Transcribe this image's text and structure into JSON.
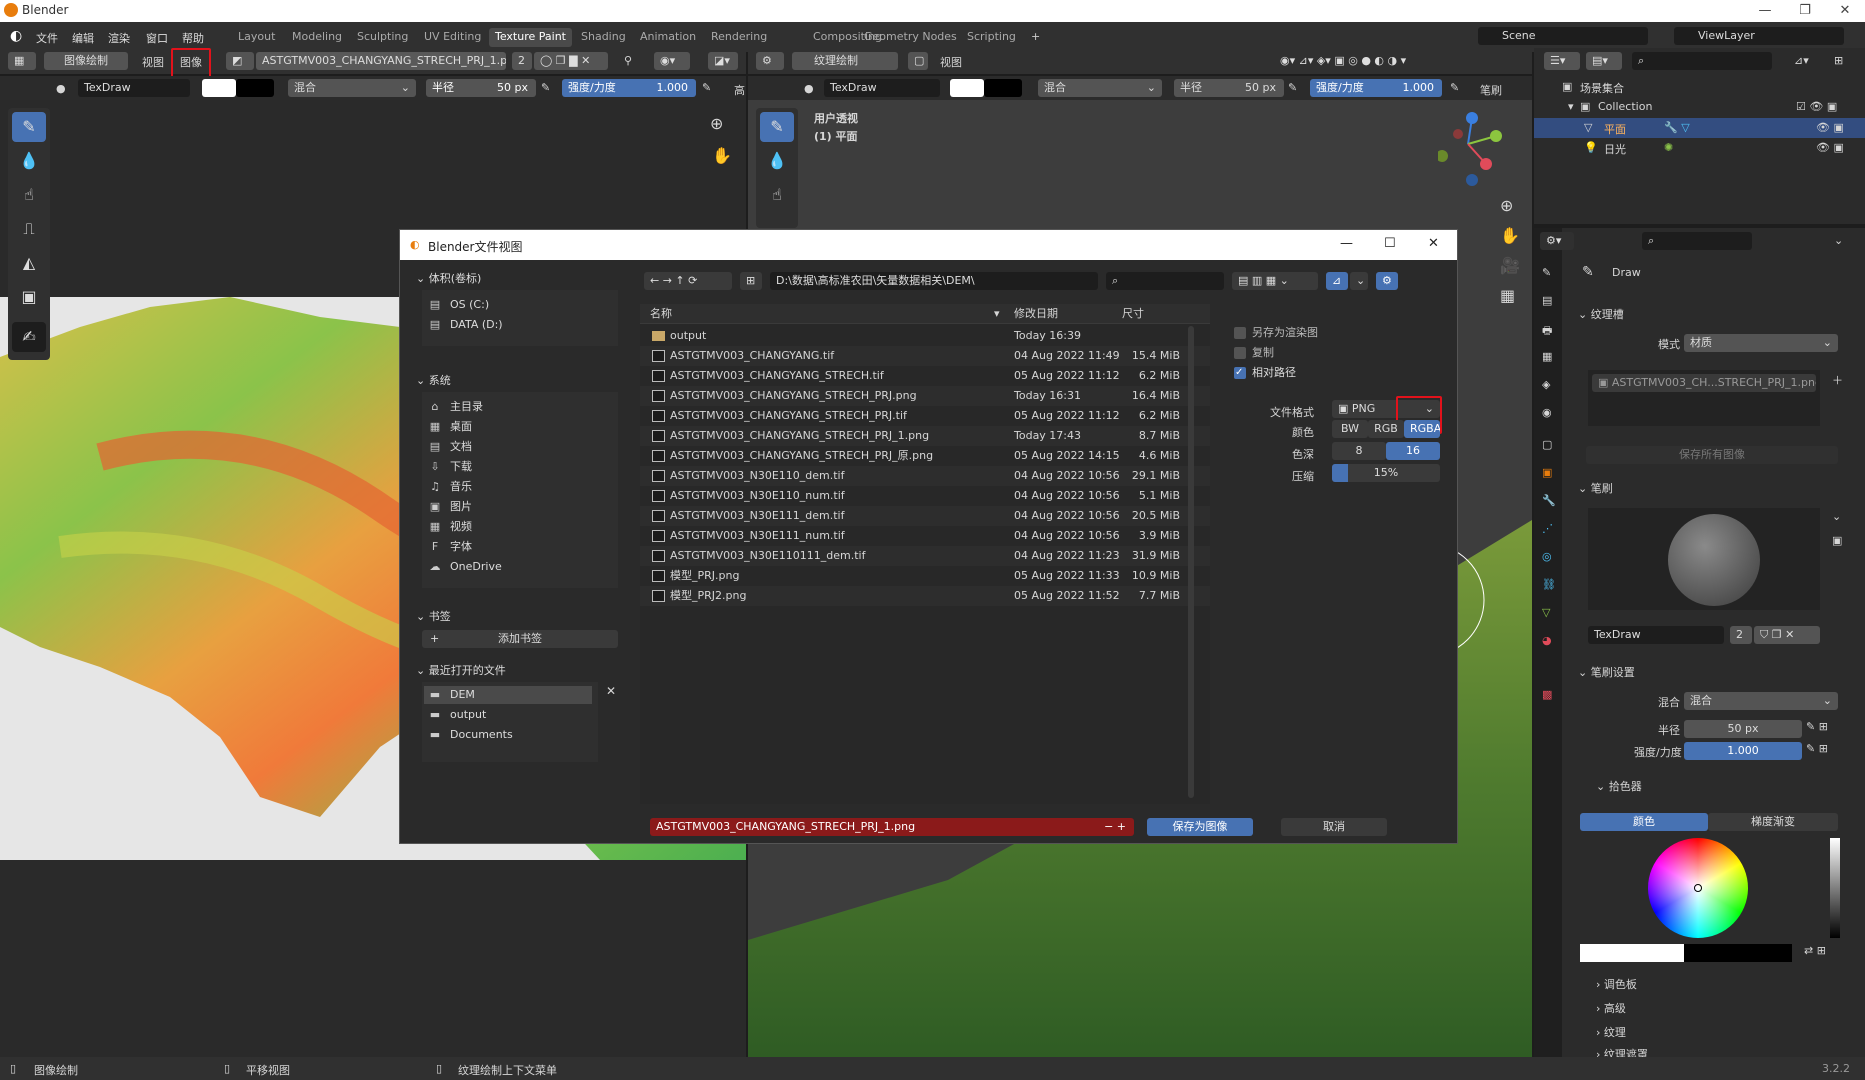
{
  "window": {
    "title": "Blender",
    "min": "—",
    "max": "❐",
    "close": "✕"
  },
  "menu": [
    "文件",
    "编辑",
    "渲染",
    "窗口",
    "帮助"
  ],
  "workspaces": [
    "Layout",
    "Modeling",
    "Sculpting",
    "UV Editing",
    "Texture Paint",
    "Shading",
    "Animation",
    "Rendering",
    "Compositing",
    "Geometry Nodes",
    "Scripting"
  ],
  "workspace_add": "+",
  "active_workspace": "Texture Paint",
  "scene": {
    "label": "Scene",
    "viewlayer": "ViewLayer"
  },
  "image_editor": {
    "mode": "图像绘制",
    "view": "视图",
    "image": "图像",
    "image_name": "ASTGTMV003_CHANGYANG_STRECH_PRJ_1.png",
    "users": "2",
    "brush": "TexDraw",
    "blend": "混合",
    "radius_label": "半径",
    "radius": "50 px",
    "strength_label": "强度/力度",
    "strength": "1.000",
    "more": "高"
  },
  "viewport": {
    "mode": "纹理绘制",
    "view": "视图",
    "brush": "TexDraw",
    "blend": "混合",
    "radius_label": "半径",
    "radius": "50 px",
    "strength_label": "强度/力度",
    "strength": "1.000",
    "brush_menu": "笔刷",
    "overlay_title": "用户透视",
    "overlay_sub": "(1) 平面"
  },
  "outliner": {
    "root": "场景集合",
    "collection": "Collection",
    "items": [
      "平面",
      "日光"
    ]
  },
  "properties": {
    "tool": "Draw",
    "texture_slots": "纹理槽",
    "mode_label": "模式",
    "mode_value": "材质",
    "slot_image": "ASTGTMV003_CH...STRECH_PRJ_1.png",
    "save_all": "保存所有图像",
    "brush_section": "笔刷",
    "brush_name": "TexDraw",
    "brush_users": "2",
    "brush_settings": "笔刷设置",
    "blend_label": "混合",
    "blend_value": "混合",
    "radius_label": "半径",
    "radius": "50 px",
    "strength_label": "强度/力度",
    "strength": "1.000",
    "color_picker": "拾色器",
    "tab_color": "颜色",
    "tab_gradient": "梯度渐变",
    "palette": "调色板",
    "advanced": "高级",
    "texture": "纹理",
    "texture_mask": "纹理遮罩"
  },
  "dialog": {
    "title": "Blender文件视图",
    "path": "D:\\数据\\高标准农田\\矢量数据相关\\DEM\\",
    "volumes_header": "体积(卷标)",
    "volumes": [
      "OS (C:)",
      "DATA (D:)"
    ],
    "system_header": "系统",
    "system": [
      "主目录",
      "桌面",
      "文档",
      "下载",
      "音乐",
      "图片",
      "视频",
      "字体",
      "OneDrive"
    ],
    "bookmarks_header": "书签",
    "add_bookmark": "添加书签",
    "recent_header": "最近打开的文件",
    "recent": [
      "DEM",
      "output",
      "Documents"
    ],
    "col_name": "名称",
    "col_date": "修改日期",
    "col_size": "尺寸",
    "files": [
      {
        "name": "output",
        "date": "Today 16:39",
        "size": "",
        "folder": true
      },
      {
        "name": "ASTGTMV003_CHANGYANG.tif",
        "date": "04 Aug 2022 11:49",
        "size": "15.4 MiB"
      },
      {
        "name": "ASTGTMV003_CHANGYANG_STRECH.tif",
        "date": "05 Aug 2022 11:12",
        "size": "6.2 MiB"
      },
      {
        "name": "ASTGTMV003_CHANGYANG_STRECH_PRJ.png",
        "date": "Today 16:31",
        "size": "16.4 MiB"
      },
      {
        "name": "ASTGTMV003_CHANGYANG_STRECH_PRJ.tif",
        "date": "05 Aug 2022 11:12",
        "size": "6.2 MiB"
      },
      {
        "name": "ASTGTMV003_CHANGYANG_STRECH_PRJ_1.png",
        "date": "Today 17:43",
        "size": "8.7 MiB"
      },
      {
        "name": "ASTGTMV003_CHANGYANG_STRECH_PRJ_原.png",
        "date": "05 Aug 2022 14:15",
        "size": "4.6 MiB"
      },
      {
        "name": "ASTGTMV003_N30E110_dem.tif",
        "date": "04 Aug 2022 10:56",
        "size": "29.1 MiB"
      },
      {
        "name": "ASTGTMV003_N30E110_num.tif",
        "date": "04 Aug 2022 10:56",
        "size": "5.1 MiB"
      },
      {
        "name": "ASTGTMV003_N30E111_dem.tif",
        "date": "04 Aug 2022 10:56",
        "size": "20.5 MiB"
      },
      {
        "name": "ASTGTMV003_N30E111_num.tif",
        "date": "04 Aug 2022 10:56",
        "size": "3.9 MiB"
      },
      {
        "name": "ASTGTMV003_N30E110111_dem.tif",
        "date": "04 Aug 2022 11:23",
        "size": "31.9 MiB"
      },
      {
        "name": "模型_PRJ.png",
        "date": "05 Aug 2022 11:33",
        "size": "10.9 MiB"
      },
      {
        "name": "模型_PRJ2.png",
        "date": "05 Aug 2022 11:52",
        "size": "7.7 MiB"
      }
    ],
    "opt_render": "另存为渲染图",
    "opt_copy": "复制",
    "opt_relative": "相对路径",
    "format_label": "文件格式",
    "format_value": "PNG",
    "color_label": "颜色",
    "color_opts": [
      "BW",
      "RGB",
      "RGBA"
    ],
    "depth_label": "色深",
    "depth_opts": [
      "8",
      "16"
    ],
    "compress_label": "压缩",
    "compress_value": "15%",
    "compress_fraction": 0.15,
    "filename": "ASTGTMV003_CHANGYANG_STRECH_PRJ_1.png",
    "save_btn": "保存为图像",
    "cancel_btn": "取消"
  },
  "status": {
    "left": "图像绘制",
    "mid": "平移视图",
    "right": "纹理绘制上下文菜单",
    "version": "3.2.2"
  }
}
